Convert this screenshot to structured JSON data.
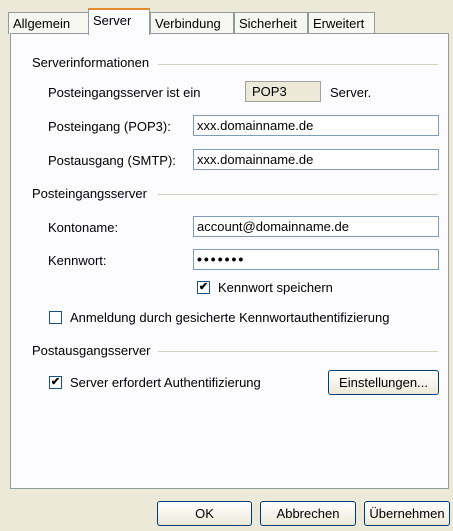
{
  "tabs": [
    "Allgemein",
    "Server",
    "Verbindung",
    "Sicherheit",
    "Erweitert"
  ],
  "server_info": {
    "title": "Serverinformationen",
    "incoming_type_label": "Posteingangsserver ist ein",
    "incoming_type_value": "POP3",
    "incoming_type_suffix": "Server.",
    "incoming_label": "Posteingang (POP3):",
    "incoming_value": "xxx.domainname.de",
    "outgoing_label": "Postausgang (SMTP):",
    "outgoing_value": "xxx.domainname.de"
  },
  "incoming_server": {
    "title": "Posteingangsserver",
    "account_label": "Kontoname:",
    "account_value": "account@domainname.de",
    "password_label": "Kennwort:",
    "password_value": "•••••••",
    "remember_label": "Kennwort speichern",
    "remember_checked": true,
    "spa_label": "Anmeldung durch gesicherte Kennwortauthentifizierung",
    "spa_checked": false
  },
  "outgoing_server": {
    "title": "Postausgangsserver",
    "auth_label": "Server erfordert Authentifizierung",
    "auth_checked": true,
    "settings_button": "Einstellungen..."
  },
  "buttons": {
    "ok": "OK",
    "cancel": "Abbrechen",
    "apply": "Übernehmen"
  },
  "check_mark": "✔"
}
